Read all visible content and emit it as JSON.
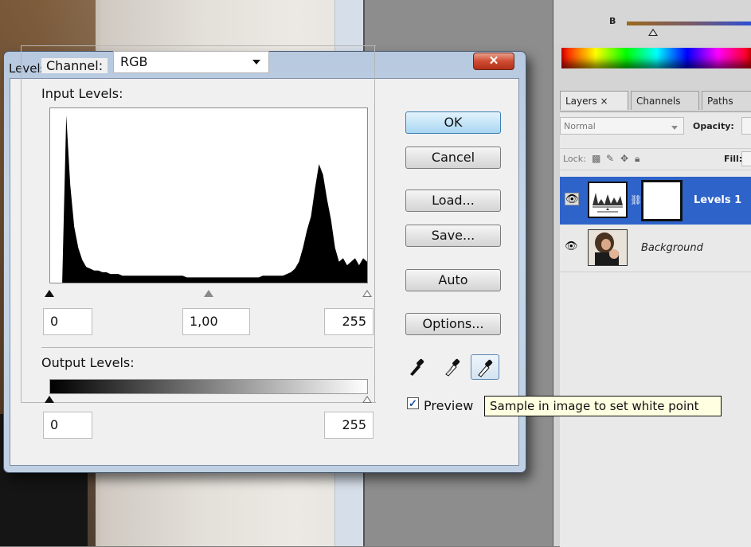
{
  "dialog": {
    "title": "Levels",
    "close_glyph": "✕",
    "channel": {
      "label": "Channel:",
      "value": "RGB"
    },
    "input_levels": {
      "label": "Input Levels:",
      "black": "0",
      "gamma": "1,00",
      "white": "255"
    },
    "output_levels": {
      "label": "Output Levels:",
      "black": "0",
      "white": "255"
    },
    "buttons": {
      "ok": "OK",
      "cancel": "Cancel",
      "load": "Load...",
      "save": "Save...",
      "auto": "Auto",
      "options": "Options..."
    },
    "eyedroppers": [
      "black-point-eyedropper",
      "gray-point-eyedropper",
      "white-point-eyedropper"
    ],
    "preview": {
      "label": "Preview",
      "checked": true
    },
    "tooltip": "Sample in image to set white point"
  },
  "histogram_levels": [
    0,
    0,
    0,
    0,
    96,
    56,
    32,
    20,
    13,
    9,
    8,
    7,
    7,
    6,
    6,
    5,
    5,
    5,
    4,
    4,
    4,
    4,
    4,
    4,
    4,
    4,
    4,
    4,
    4,
    4,
    4,
    4,
    4,
    4,
    3,
    3,
    3,
    3,
    3,
    3,
    3,
    3,
    3,
    3,
    3,
    3,
    3,
    3,
    3,
    3,
    3,
    3,
    3,
    4,
    4,
    4,
    4,
    4,
    4,
    5,
    6,
    8,
    12,
    20,
    30,
    38,
    54,
    68,
    62,
    48,
    36,
    20,
    12,
    14,
    10,
    12,
    14,
    10,
    14,
    12
  ],
  "panel": {
    "color_slider": {
      "label": "B"
    },
    "tabs": [
      "Layers ×",
      "Channels",
      "Paths"
    ],
    "blend_mode": "Normal",
    "opacity_label": "Opacity:",
    "lock_label": "Lock:",
    "fill_label": "Fill:",
    "layers": [
      {
        "name": "Levels 1",
        "selected": true
      },
      {
        "name": "Background",
        "selected": false
      }
    ]
  },
  "colors": {
    "selection": "#2e63c9",
    "ok_button": "#c6e6f8",
    "tooltip_bg": "#ffffe1"
  }
}
